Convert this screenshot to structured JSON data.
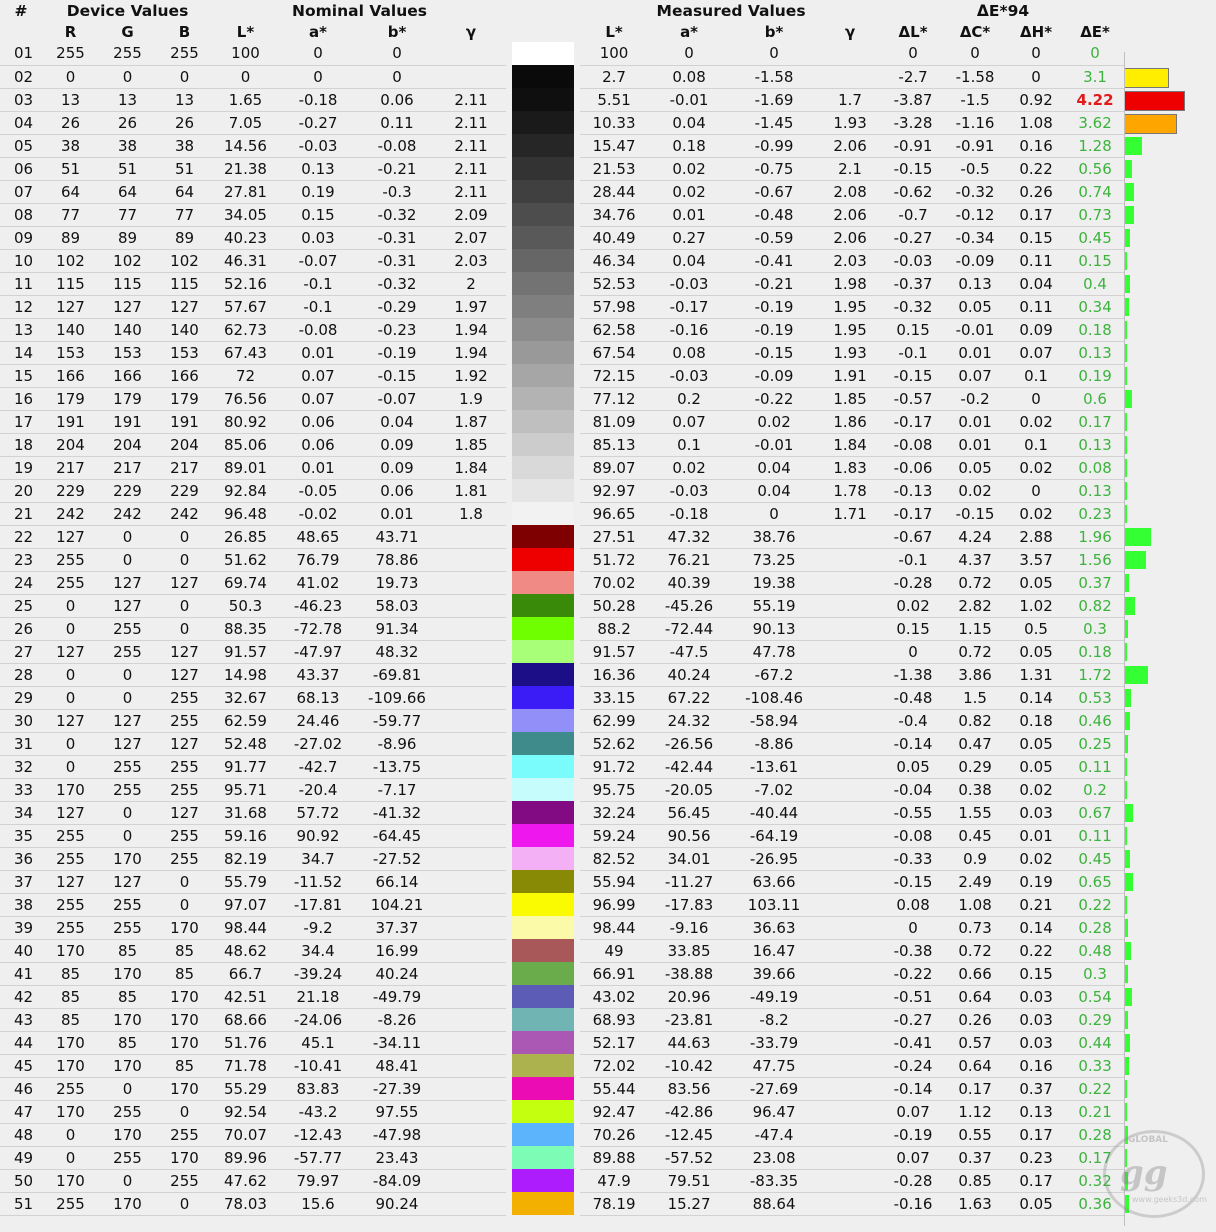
{
  "headers": {
    "group": {
      "num": "#",
      "device": "Device Values",
      "nominal": "Nominal Values",
      "measured": "Measured Values",
      "de94": "ΔE*94"
    },
    "cols": {
      "R": "R",
      "G": "G",
      "B": "B",
      "L": "L*",
      "a": "a*",
      "b": "b*",
      "g": "γ",
      "mL": "L*",
      "ma": "a*",
      "mb": "b*",
      "mg": "γ",
      "dL": "ΔL*",
      "dC": "ΔC*",
      "dH": "ΔH*",
      "dE": "ΔE*"
    }
  },
  "colors": {
    "good": "#3cb33c",
    "warn": "#ffa500",
    "yellow": "#ffee00",
    "bad": "#ee0000",
    "bar_green": "#33ff33"
  },
  "logo": {
    "top": "GLOBAL",
    "mark": "gg",
    "url": "www.geeks3d.com"
  },
  "rows": [
    [
      "01",
      "255",
      "255",
      "255",
      "100",
      "0",
      "0",
      "",
      "#ffffff",
      "100",
      "0",
      "0",
      "",
      "0",
      "0",
      "0",
      "0"
    ],
    [
      "02",
      "0",
      "0",
      "0",
      "0",
      "0",
      "0",
      "",
      "#0a0a0a",
      "2.7",
      "0.08",
      "-1.58",
      "",
      "-2.7",
      "-1.58",
      "0",
      "3.1"
    ],
    [
      "03",
      "13",
      "13",
      "13",
      "1.65",
      "-0.18",
      "0.06",
      "2.11",
      "#0f0f0f",
      "5.51",
      "-0.01",
      "-1.69",
      "1.7",
      "-3.87",
      "-1.5",
      "0.92",
      "4.22"
    ],
    [
      "04",
      "26",
      "26",
      "26",
      "7.05",
      "-0.27",
      "0.11",
      "2.11",
      "#1a1a1a",
      "10.33",
      "0.04",
      "-1.45",
      "1.93",
      "-3.28",
      "-1.16",
      "1.08",
      "3.62"
    ],
    [
      "05",
      "38",
      "38",
      "38",
      "14.56",
      "-0.03",
      "-0.08",
      "2.11",
      "#262626",
      "15.47",
      "0.18",
      "-0.99",
      "2.06",
      "-0.91",
      "-0.91",
      "0.16",
      "1.28"
    ],
    [
      "06",
      "51",
      "51",
      "51",
      "21.38",
      "0.13",
      "-0.21",
      "2.11",
      "#333333",
      "21.53",
      "0.02",
      "-0.75",
      "2.1",
      "-0.15",
      "-0.5",
      "0.22",
      "0.56"
    ],
    [
      "07",
      "64",
      "64",
      "64",
      "27.81",
      "0.19",
      "-0.3",
      "2.11",
      "#404040",
      "28.44",
      "0.02",
      "-0.67",
      "2.08",
      "-0.62",
      "-0.32",
      "0.26",
      "0.74"
    ],
    [
      "08",
      "77",
      "77",
      "77",
      "34.05",
      "0.15",
      "-0.32",
      "2.09",
      "#4d4d4d",
      "34.76",
      "0.01",
      "-0.48",
      "2.06",
      "-0.7",
      "-0.12",
      "0.17",
      "0.73"
    ],
    [
      "09",
      "89",
      "89",
      "89",
      "40.23",
      "0.03",
      "-0.31",
      "2.07",
      "#595959",
      "40.49",
      "0.27",
      "-0.59",
      "2.06",
      "-0.27",
      "-0.34",
      "0.15",
      "0.45"
    ],
    [
      "10",
      "102",
      "102",
      "102",
      "46.31",
      "-0.07",
      "-0.31",
      "2.03",
      "#666666",
      "46.34",
      "0.04",
      "-0.41",
      "2.03",
      "-0.03",
      "-0.09",
      "0.11",
      "0.15"
    ],
    [
      "11",
      "115",
      "115",
      "115",
      "52.16",
      "-0.1",
      "-0.32",
      "2",
      "#737373",
      "52.53",
      "-0.03",
      "-0.21",
      "1.98",
      "-0.37",
      "0.13",
      "0.04",
      "0.4"
    ],
    [
      "12",
      "127",
      "127",
      "127",
      "57.67",
      "-0.1",
      "-0.29",
      "1.97",
      "#7f7f7f",
      "57.98",
      "-0.17",
      "-0.19",
      "1.95",
      "-0.32",
      "0.05",
      "0.11",
      "0.34"
    ],
    [
      "13",
      "140",
      "140",
      "140",
      "62.73",
      "-0.08",
      "-0.23",
      "1.94",
      "#8c8c8c",
      "62.58",
      "-0.16",
      "-0.19",
      "1.95",
      "0.15",
      "-0.01",
      "0.09",
      "0.18"
    ],
    [
      "14",
      "153",
      "153",
      "153",
      "67.43",
      "0.01",
      "-0.19",
      "1.94",
      "#999999",
      "67.54",
      "0.08",
      "-0.15",
      "1.93",
      "-0.1",
      "0.01",
      "0.07",
      "0.13"
    ],
    [
      "15",
      "166",
      "166",
      "166",
      "72",
      "0.07",
      "-0.15",
      "1.92",
      "#a6a6a6",
      "72.15",
      "-0.03",
      "-0.09",
      "1.91",
      "-0.15",
      "0.07",
      "0.1",
      "0.19"
    ],
    [
      "16",
      "179",
      "179",
      "179",
      "76.56",
      "0.07",
      "-0.07",
      "1.9",
      "#b3b3b3",
      "77.12",
      "0.2",
      "-0.22",
      "1.85",
      "-0.57",
      "-0.2",
      "0",
      "0.6"
    ],
    [
      "17",
      "191",
      "191",
      "191",
      "80.92",
      "0.06",
      "0.04",
      "1.87",
      "#bfbfbf",
      "81.09",
      "0.07",
      "0.02",
      "1.86",
      "-0.17",
      "0.01",
      "0.02",
      "0.17"
    ],
    [
      "18",
      "204",
      "204",
      "204",
      "85.06",
      "0.06",
      "0.09",
      "1.85",
      "#cccccc",
      "85.13",
      "0.1",
      "-0.01",
      "1.84",
      "-0.08",
      "0.01",
      "0.1",
      "0.13"
    ],
    [
      "19",
      "217",
      "217",
      "217",
      "89.01",
      "0.01",
      "0.09",
      "1.84",
      "#d9d9d9",
      "89.07",
      "0.02",
      "0.04",
      "1.83",
      "-0.06",
      "0.05",
      "0.02",
      "0.08"
    ],
    [
      "20",
      "229",
      "229",
      "229",
      "92.84",
      "-0.05",
      "0.06",
      "1.81",
      "#e5e5e5",
      "92.97",
      "-0.03",
      "0.04",
      "1.78",
      "-0.13",
      "0.02",
      "0",
      "0.13"
    ],
    [
      "21",
      "242",
      "242",
      "242",
      "96.48",
      "-0.02",
      "0.01",
      "1.8",
      "#f2f2f2",
      "96.65",
      "-0.18",
      "0",
      "1.71",
      "-0.17",
      "-0.15",
      "0.02",
      "0.23"
    ],
    [
      "22",
      "127",
      "0",
      "0",
      "26.85",
      "48.65",
      "43.71",
      "",
      "#7f0000",
      "27.51",
      "47.32",
      "38.76",
      "",
      "-0.67",
      "4.24",
      "2.88",
      "1.96"
    ],
    [
      "23",
      "255",
      "0",
      "0",
      "51.62",
      "76.79",
      "78.86",
      "",
      "#ee0000",
      "51.72",
      "76.21",
      "73.25",
      "",
      "-0.1",
      "4.37",
      "3.57",
      "1.56"
    ],
    [
      "24",
      "255",
      "127",
      "127",
      "69.74",
      "41.02",
      "19.73",
      "",
      "#f08a84",
      "70.02",
      "40.39",
      "19.38",
      "",
      "-0.28",
      "0.72",
      "0.05",
      "0.37"
    ],
    [
      "25",
      "0",
      "127",
      "0",
      "50.3",
      "-46.23",
      "58.03",
      "",
      "#3a8a0a",
      "50.28",
      "-45.26",
      "55.19",
      "",
      "0.02",
      "2.82",
      "1.02",
      "0.82"
    ],
    [
      "26",
      "0",
      "255",
      "0",
      "88.35",
      "-72.78",
      "91.34",
      "",
      "#70ff00",
      "88.2",
      "-72.44",
      "90.13",
      "",
      "0.15",
      "1.15",
      "0.5",
      "0.3"
    ],
    [
      "27",
      "127",
      "255",
      "127",
      "91.57",
      "-47.97",
      "48.32",
      "",
      "#a8ff78",
      "91.57",
      "-47.5",
      "47.78",
      "",
      "0",
      "0.72",
      "0.05",
      "0.18"
    ],
    [
      "28",
      "0",
      "0",
      "127",
      "14.98",
      "43.37",
      "-69.81",
      "",
      "#1c0e86",
      "16.36",
      "40.24",
      "-67.2",
      "",
      "-1.38",
      "3.86",
      "1.31",
      "1.72"
    ],
    [
      "29",
      "0",
      "0",
      "255",
      "32.67",
      "68.13",
      "-109.66",
      "",
      "#3c1cf6",
      "33.15",
      "67.22",
      "-108.46",
      "",
      "-0.48",
      "1.5",
      "0.14",
      "0.53"
    ],
    [
      "30",
      "127",
      "127",
      "255",
      "62.59",
      "24.46",
      "-59.77",
      "",
      "#9290f8",
      "62.99",
      "24.32",
      "-58.94",
      "",
      "-0.4",
      "0.82",
      "0.18",
      "0.46"
    ],
    [
      "31",
      "0",
      "127",
      "127",
      "52.48",
      "-27.02",
      "-8.96",
      "",
      "#3f8b8b",
      "52.62",
      "-26.56",
      "-8.86",
      "",
      "-0.14",
      "0.47",
      "0.05",
      "0.25"
    ],
    [
      "32",
      "0",
      "255",
      "255",
      "91.77",
      "-42.7",
      "-13.75",
      "",
      "#7afcfc",
      "91.72",
      "-42.44",
      "-13.61",
      "",
      "0.05",
      "0.29",
      "0.05",
      "0.11"
    ],
    [
      "33",
      "170",
      "255",
      "255",
      "95.71",
      "-20.4",
      "-7.17",
      "",
      "#c6fcfc",
      "95.75",
      "-20.05",
      "-7.02",
      "",
      "-0.04",
      "0.38",
      "0.02",
      "0.2"
    ],
    [
      "34",
      "127",
      "0",
      "127",
      "31.68",
      "57.72",
      "-41.32",
      "",
      "#820a82",
      "32.24",
      "56.45",
      "-40.44",
      "",
      "-0.55",
      "1.55",
      "0.03",
      "0.67"
    ],
    [
      "35",
      "255",
      "0",
      "255",
      "59.16",
      "90.92",
      "-64.45",
      "",
      "#ee18ee",
      "59.24",
      "90.56",
      "-64.19",
      "",
      "-0.08",
      "0.45",
      "0.01",
      "0.11"
    ],
    [
      "36",
      "255",
      "170",
      "255",
      "82.19",
      "34.7",
      "-27.52",
      "",
      "#f4b0f4",
      "82.52",
      "34.01",
      "-26.95",
      "",
      "-0.33",
      "0.9",
      "0.02",
      "0.45"
    ],
    [
      "37",
      "127",
      "127",
      "0",
      "55.79",
      "-11.52",
      "66.14",
      "",
      "#888a06",
      "55.94",
      "-11.27",
      "63.66",
      "",
      "-0.15",
      "2.49",
      "0.19",
      "0.65"
    ],
    [
      "38",
      "255",
      "255",
      "0",
      "97.07",
      "-17.81",
      "104.21",
      "",
      "#fafa00",
      "96.99",
      "-17.83",
      "103.11",
      "",
      "0.08",
      "1.08",
      "0.21",
      "0.22"
    ],
    [
      "39",
      "255",
      "255",
      "170",
      "98.44",
      "-9.2",
      "37.37",
      "",
      "#fafaa8",
      "98.44",
      "-9.16",
      "36.63",
      "",
      "0",
      "0.73",
      "0.14",
      "0.28"
    ],
    [
      "40",
      "170",
      "85",
      "85",
      "48.62",
      "34.4",
      "16.99",
      "",
      "#a85858",
      "49",
      "33.85",
      "16.47",
      "",
      "-0.38",
      "0.72",
      "0.22",
      "0.48"
    ],
    [
      "41",
      "85",
      "170",
      "85",
      "66.7",
      "-39.24",
      "40.24",
      "",
      "#6aac4c",
      "66.91",
      "-38.88",
      "39.66",
      "",
      "-0.22",
      "0.66",
      "0.15",
      "0.3"
    ],
    [
      "42",
      "85",
      "85",
      "170",
      "42.51",
      "21.18",
      "-49.79",
      "",
      "#5c5cb6",
      "43.02",
      "20.96",
      "-49.19",
      "",
      "-0.51",
      "0.64",
      "0.03",
      "0.54"
    ],
    [
      "43",
      "85",
      "170",
      "170",
      "68.66",
      "-24.06",
      "-8.26",
      "",
      "#70b4b4",
      "68.93",
      "-23.81",
      "-8.2",
      "",
      "-0.27",
      "0.26",
      "0.03",
      "0.29"
    ],
    [
      "44",
      "170",
      "85",
      "170",
      "51.76",
      "45.1",
      "-34.11",
      "",
      "#aa58b4",
      "52.17",
      "44.63",
      "-33.79",
      "",
      "-0.41",
      "0.57",
      "0.03",
      "0.44"
    ],
    [
      "45",
      "170",
      "170",
      "85",
      "71.78",
      "-10.41",
      "48.41",
      "",
      "#acb24e",
      "72.02",
      "-10.42",
      "47.75",
      "",
      "-0.24",
      "0.64",
      "0.16",
      "0.33"
    ],
    [
      "46",
      "255",
      "0",
      "170",
      "55.29",
      "83.83",
      "-27.39",
      "",
      "#ec0cb4",
      "55.44",
      "83.56",
      "-27.69",
      "",
      "-0.14",
      "0.17",
      "0.37",
      "0.22"
    ],
    [
      "47",
      "170",
      "255",
      "0",
      "92.54",
      "-43.2",
      "97.55",
      "",
      "#c4ff10",
      "92.47",
      "-42.86",
      "96.47",
      "",
      "0.07",
      "1.12",
      "0.13",
      "0.21"
    ],
    [
      "48",
      "0",
      "170",
      "255",
      "70.07",
      "-12.43",
      "-47.98",
      "",
      "#5cb4fc",
      "70.26",
      "-12.45",
      "-47.4",
      "",
      "-0.19",
      "0.55",
      "0.17",
      "0.28"
    ],
    [
      "49",
      "0",
      "255",
      "170",
      "89.96",
      "-57.77",
      "23.43",
      "",
      "#7cfcb4",
      "89.88",
      "-57.52",
      "23.08",
      "",
      "0.07",
      "0.37",
      "0.23",
      "0.17"
    ],
    [
      "50",
      "170",
      "0",
      "255",
      "47.62",
      "79.97",
      "-84.09",
      "",
      "#ac1cfc",
      "47.9",
      "79.51",
      "-83.35",
      "",
      "-0.28",
      "0.85",
      "0.17",
      "0.32"
    ],
    [
      "51",
      "255",
      "170",
      "0",
      "78.03",
      "15.6",
      "90.24",
      "",
      "#f4b000",
      "78.19",
      "15.27",
      "88.64",
      "",
      "-0.16",
      "1.63",
      "0.05",
      "0.36"
    ]
  ]
}
